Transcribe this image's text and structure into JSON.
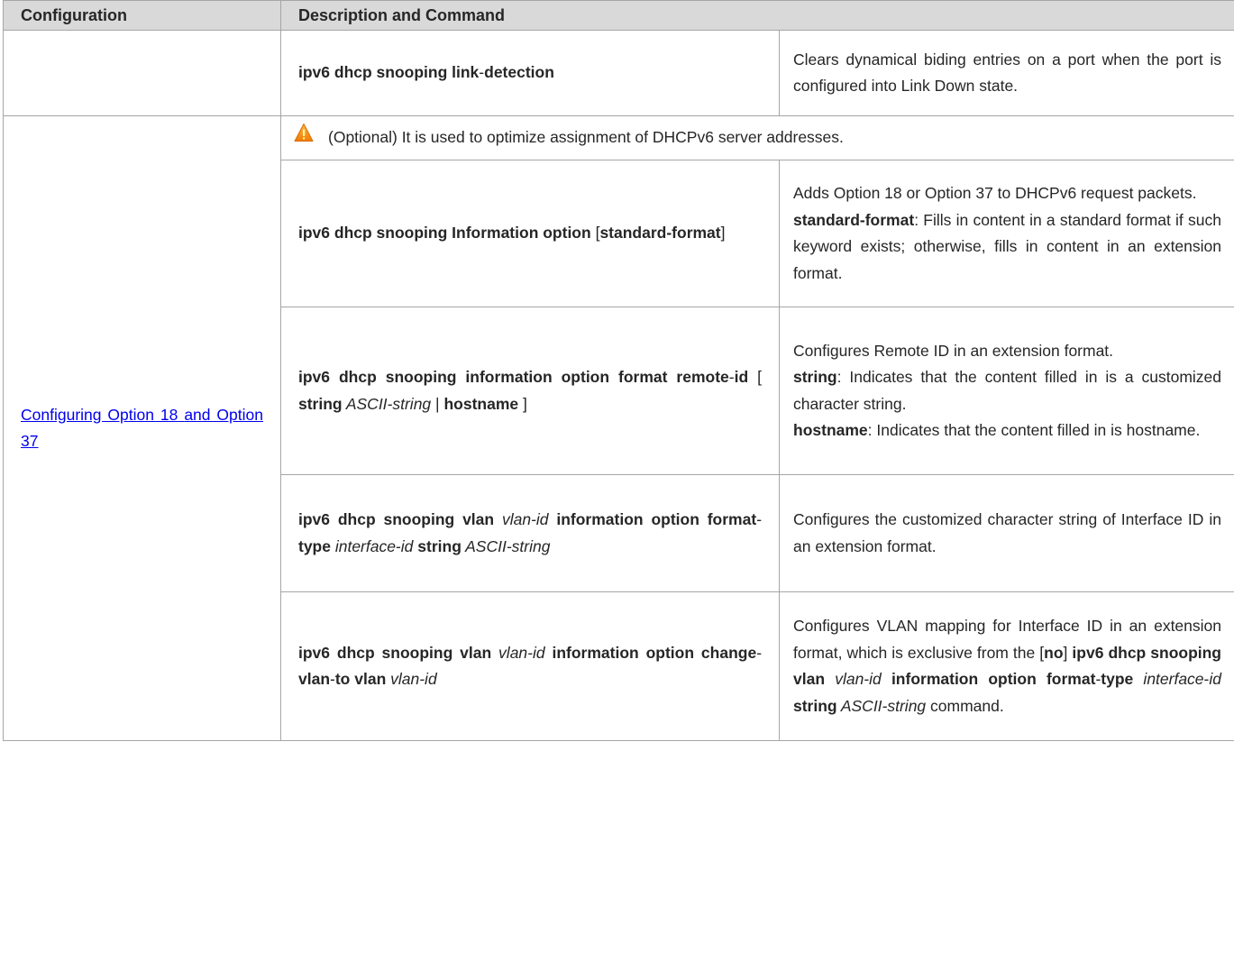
{
  "header": {
    "col1": "Configuration",
    "col2": "Description and Command"
  },
  "row1": {
    "command": {
      "b1": "ipv6 dhcp snooping link",
      "t1": "-",
      "b2": "detection"
    },
    "description": "Clears dynamical biding entries on a port when the port is configured into Link Down state."
  },
  "group": {
    "link": {
      "line1": "Configuring Option 18",
      "line2": "and Option 37"
    },
    "note": {
      "icon": "warning-icon",
      "text": "(Optional) It is used to optimize assignment of DHCPv6 server addresses."
    },
    "rows": [
      {
        "command": {
          "b1": "ipv6 dhcp snooping  Information option",
          "t1": " [",
          "b2": "standard",
          "t2": "-",
          "b3": "format",
          "t3": "]"
        },
        "description": {
          "d1": "Adds Option 18 or Option 37 to DHCPv6 request packets.",
          "k1": "standard-format",
          "d2": ": Fills in content in a standard format if such keyword exists; otherwise, fills in content in an extension format."
        }
      },
      {
        "command": {
          "b1": "ipv6 dhcp snooping information option format remote",
          "t1": "-",
          "b2": "id",
          "t2": " [ ",
          "b3": "string",
          "i1": " ASCII-string",
          "t3": " | ",
          "b4": "hostname",
          "t4": " ]"
        },
        "description": {
          "d1": "Configures Remote ID in an extension format.",
          "k1": "string",
          "d2": ": Indicates that the content filled in is a customized character string.",
          "k2": "hostname",
          "d3": ": Indicates that the content filled in is hostname."
        }
      },
      {
        "command": {
          "b1": "ipv6 dhcp snooping vlan",
          "i1": " vlan-id ",
          "b2": "information option format",
          "t1": "-",
          "b3": "type",
          "i2": " interface",
          "t2": "-",
          "i3": "id",
          "b4": " string",
          "i4": " ASCII-string"
        },
        "description": "Configures the customized character string of Interface ID in an extension format."
      },
      {
        "command": {
          "b1": "ipv6 dhcp snooping vlan",
          "i1": " vlan-id ",
          "b2": "information option change",
          "t1": "-",
          "b3": "vlan",
          "t2": "-",
          "b4": "to vlan",
          "i2": " vlan-id"
        },
        "description": {
          "d1": "Configures VLAN mapping for Interface ID in an extension format, which is exclusive from the [",
          "k1": "no",
          "d2": "] ",
          "k2": "ipv6 dhcp snooping vlan",
          "i1": " vlan-id ",
          "k3": "information option format",
          "d3": "-",
          "k4": "type",
          "i2": " interface",
          "d4": "-",
          "i3": "id",
          "k5": " string",
          "i4": " ASCII-string",
          "d5": " command."
        }
      }
    ]
  },
  "colors": {
    "header_bg": "#d9d9d9",
    "border": "#a6a6a6",
    "link": "#0000ee",
    "warning": "#f39c12"
  }
}
